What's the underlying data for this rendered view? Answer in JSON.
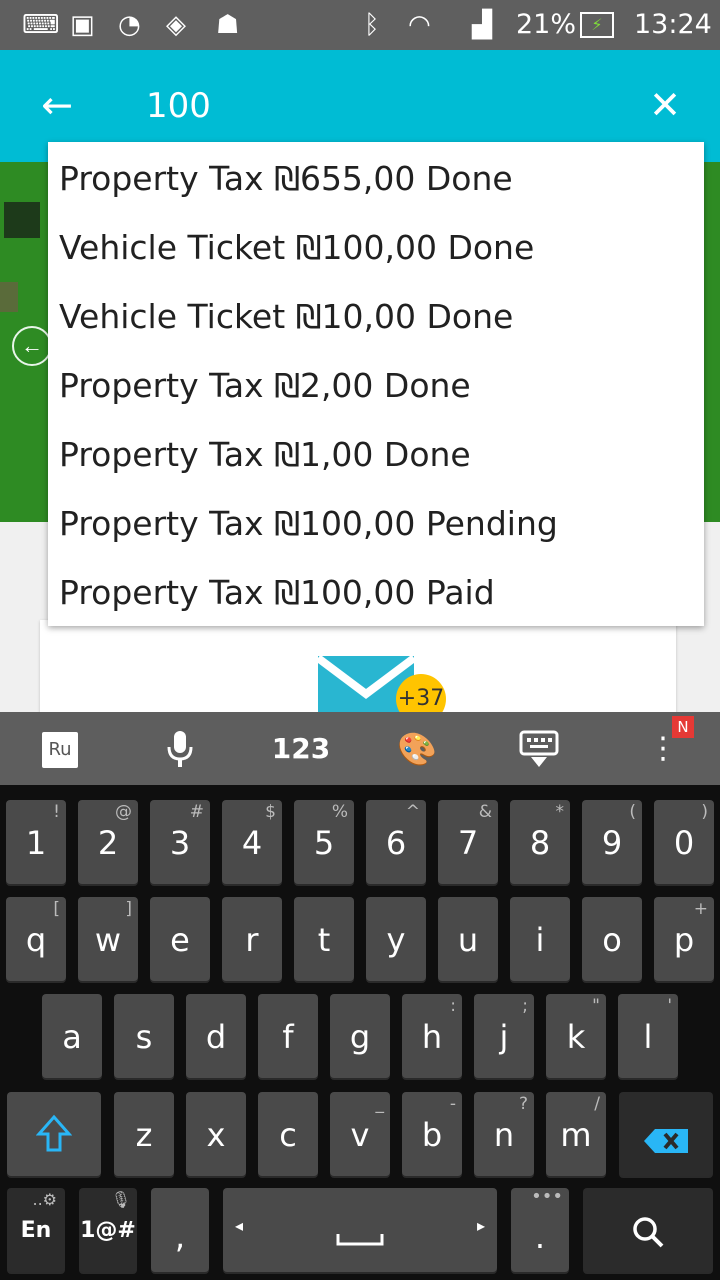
{
  "status_bar": {
    "battery": "21%",
    "time": "13:24",
    "icons": [
      "keyboard-icon",
      "gallery-icon",
      "speed-icon",
      "lion-app-icon",
      "android-icon",
      "bluetooth-icon",
      "wifi-icon",
      "signal-icon",
      "battery-charging-icon"
    ]
  },
  "search": {
    "query": "100"
  },
  "suggestions": [
    "Property Tax ₪655,00 Done",
    "Vehicle Ticket ₪100,00 Done",
    "Vehicle Ticket ₪10,00 Done",
    "Property Tax ₪2,00 Done",
    "Property Tax ₪1,00 Done",
    "Property Tax ₪100,00 Pending",
    "Property Tax ₪100,00 Paid"
  ],
  "background": {
    "mail_badge": "+37"
  },
  "keyboard_toolbar": {
    "lang": "Ru",
    "numbers": "123",
    "notification": "N"
  },
  "keyboard": {
    "row_numbers": [
      {
        "k": "1",
        "h": "!"
      },
      {
        "k": "2",
        "h": "@"
      },
      {
        "k": "3",
        "h": "#"
      },
      {
        "k": "4",
        "h": "$"
      },
      {
        "k": "5",
        "h": "%"
      },
      {
        "k": "6",
        "h": "^"
      },
      {
        "k": "7",
        "h": "&"
      },
      {
        "k": "8",
        "h": "*"
      },
      {
        "k": "9",
        "h": "("
      },
      {
        "k": "0",
        "h": ")"
      }
    ],
    "row_top": [
      {
        "k": "q",
        "h": "["
      },
      {
        "k": "w",
        "h": "]"
      },
      {
        "k": "e",
        "h": ""
      },
      {
        "k": "r",
        "h": ""
      },
      {
        "k": "t",
        "h": ""
      },
      {
        "k": "y",
        "h": ""
      },
      {
        "k": "u",
        "h": ""
      },
      {
        "k": "i",
        "h": ""
      },
      {
        "k": "o",
        "h": ""
      },
      {
        "k": "p",
        "h": "+"
      }
    ],
    "row_mid": [
      {
        "k": "a",
        "h": ""
      },
      {
        "k": "s",
        "h": ""
      },
      {
        "k": "d",
        "h": ""
      },
      {
        "k": "f",
        "h": ""
      },
      {
        "k": "g",
        "h": ""
      },
      {
        "k": "h",
        "h": ":"
      },
      {
        "k": "j",
        "h": ";"
      },
      {
        "k": "k",
        "h": "\""
      },
      {
        "k": "l",
        "h": "'"
      }
    ],
    "row_bottom": [
      {
        "k": "z",
        "h": ""
      },
      {
        "k": "x",
        "h": ""
      },
      {
        "k": "c",
        "h": ""
      },
      {
        "k": "v",
        "h": "_"
      },
      {
        "k": "b",
        "h": "-"
      },
      {
        "k": "n",
        "h": "?"
      },
      {
        "k": "m",
        "h": "/"
      }
    ],
    "lang_key": "En",
    "symbols_key": "1@#",
    "comma": ",",
    "period": "."
  }
}
